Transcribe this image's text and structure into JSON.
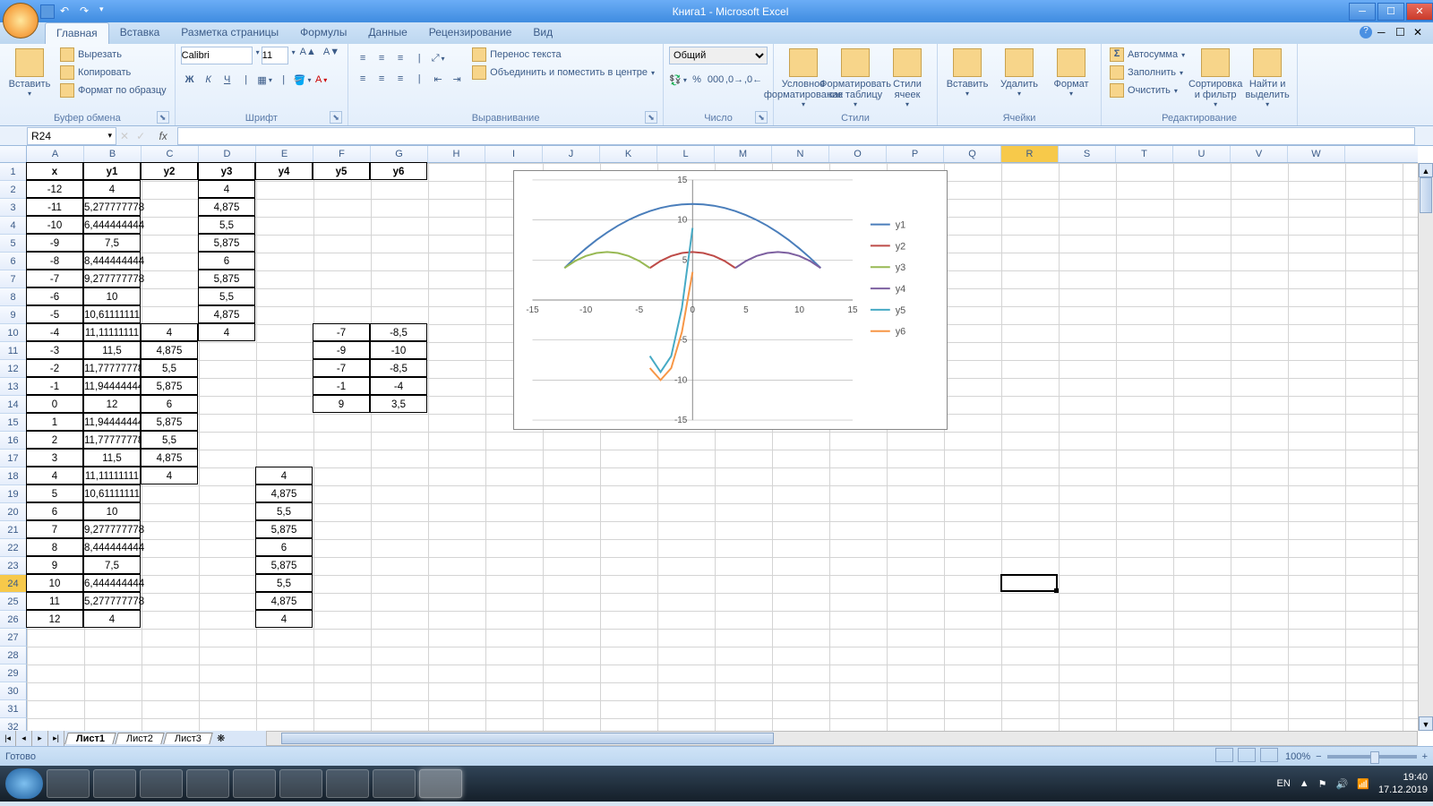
{
  "window": {
    "title": "Книга1 - Microsoft Excel"
  },
  "ribbon_tabs": [
    "Главная",
    "Вставка",
    "Разметка страницы",
    "Формулы",
    "Данные",
    "Рецензирование",
    "Вид"
  ],
  "ribbon": {
    "clipboard": {
      "paste": "Вставить",
      "cut": "Вырезать",
      "copy": "Копировать",
      "format_painter": "Формат по образцу",
      "group": "Буфер обмена"
    },
    "font": {
      "name": "Calibri",
      "size": "11",
      "group": "Шрифт",
      "bold": "Ж",
      "italic": "К",
      "underline": "Ч"
    },
    "align": {
      "wrap": "Перенос текста",
      "merge": "Объединить и поместить в центре",
      "group": "Выравнивание"
    },
    "number": {
      "format": "Общий",
      "group": "Число"
    },
    "styles": {
      "cond": "Условное форматирование",
      "table": "Форматировать как таблицу",
      "cell": "Стили ячеек",
      "group": "Стили"
    },
    "cells": {
      "insert": "Вставить",
      "delete": "Удалить",
      "format": "Формат",
      "group": "Ячейки"
    },
    "editing": {
      "autosum": "Автосумма",
      "fill": "Заполнить",
      "clear": "Очистить",
      "sort": "Сортировка и фильтр",
      "find": "Найти и выделить",
      "group": "Редактирование"
    }
  },
  "namebox": "R24",
  "formula": "",
  "columns": [
    "A",
    "B",
    "C",
    "D",
    "E",
    "F",
    "G",
    "H",
    "I",
    "J",
    "K",
    "L",
    "M",
    "N",
    "O",
    "P",
    "Q",
    "R",
    "S",
    "T",
    "U",
    "V",
    "W"
  ],
  "rows_count": 32,
  "selected_cell": {
    "col": 17,
    "row": 23
  },
  "selected_row_header": 24,
  "selected_col_header": "R",
  "headers_row": [
    "x",
    "y1",
    "y2",
    "y3",
    "y4",
    "y5",
    "y6"
  ],
  "col_a": [
    "-12",
    "-11",
    "-10",
    "-9",
    "-8",
    "-7",
    "-6",
    "-5",
    "-4",
    "-3",
    "-2",
    "-1",
    "0",
    "1",
    "2",
    "3",
    "4",
    "5",
    "6",
    "7",
    "8",
    "9",
    "10",
    "11",
    "12"
  ],
  "col_b": [
    "4",
    "5,277777778",
    "6,444444444",
    "7,5",
    "8,444444444",
    "9,277777778",
    "10",
    "10,61111111",
    "11,11111111",
    "11,5",
    "11,77777778",
    "11,94444444",
    "12",
    "11,94444444",
    "11,77777778",
    "11,5",
    "11,11111111",
    "10,61111111",
    "10",
    "9,277777778",
    "8,444444444",
    "7,5",
    "6,444444444",
    "5,277777778",
    "4"
  ],
  "col_c": {
    "10": "4",
    "11": "4,875",
    "12": "5,5",
    "13": "5,875",
    "14": "6",
    "15": "5,875",
    "16": "5,5",
    "17": "4,875",
    "18": "4"
  },
  "col_d": {
    "2": "4",
    "3": "4,875",
    "4": "5,5",
    "5": "5,875",
    "6": "6",
    "7": "5,875",
    "8": "5,5",
    "9": "4,875",
    "10": "4"
  },
  "col_e": {
    "18": "4",
    "19": "4,875",
    "20": "5,5",
    "21": "5,875",
    "22": "6",
    "23": "5,875",
    "24": "5,5",
    "25": "4,875",
    "26": "4"
  },
  "col_f": {
    "10": "-7",
    "11": "-9",
    "12": "-7",
    "13": "-1",
    "14": "9"
  },
  "col_g": {
    "10": "-8,5",
    "11": "-10",
    "12": "-8,5",
    "13": "-4",
    "14": "3,5"
  },
  "sheets": [
    "Лист1",
    "Лист2",
    "Лист3"
  ],
  "status": {
    "ready": "Готово",
    "zoom": "100%"
  },
  "taskbar": {
    "lang": "EN",
    "time": "19:40",
    "date": "17.12.2019"
  },
  "chart_data": {
    "type": "line",
    "xlim": [
      -15,
      15
    ],
    "ylim": [
      -15,
      15
    ],
    "xticks": [
      -15,
      -10,
      -5,
      0,
      5,
      10,
      15
    ],
    "yticks": [
      -15,
      -10,
      -5,
      0,
      5,
      10,
      15
    ],
    "series": [
      {
        "name": "y1",
        "color": "#4a7ebb",
        "x": [
          -12,
          -11,
          -10,
          -9,
          -8,
          -7,
          -6,
          -5,
          -4,
          -3,
          -2,
          -1,
          0,
          1,
          2,
          3,
          4,
          5,
          6,
          7,
          8,
          9,
          10,
          11,
          12
        ],
        "y": [
          4,
          5.28,
          6.44,
          7.5,
          8.44,
          9.28,
          10,
          10.61,
          11.11,
          11.5,
          11.78,
          11.94,
          12,
          11.94,
          11.78,
          11.5,
          11.11,
          10.61,
          10,
          9.28,
          8.44,
          7.5,
          6.44,
          5.28,
          4
        ]
      },
      {
        "name": "y2",
        "color": "#be4b48",
        "x": [
          -4,
          -3,
          -2,
          -1,
          0,
          1,
          2,
          3,
          4
        ],
        "y": [
          4,
          4.875,
          5.5,
          5.875,
          6,
          5.875,
          5.5,
          4.875,
          4
        ]
      },
      {
        "name": "y3",
        "color": "#98b954",
        "x": [
          -12,
          -11,
          -10,
          -9,
          -8,
          -7,
          -6,
          -5,
          -4
        ],
        "y": [
          4,
          4.875,
          5.5,
          5.875,
          6,
          5.875,
          5.5,
          4.875,
          4
        ]
      },
      {
        "name": "y4",
        "color": "#7d60a0",
        "x": [
          4,
          5,
          6,
          7,
          8,
          9,
          10,
          11,
          12
        ],
        "y": [
          4,
          4.875,
          5.5,
          5.875,
          6,
          5.875,
          5.5,
          4.875,
          4
        ]
      },
      {
        "name": "y5",
        "color": "#46aac5",
        "x": [
          -4,
          -3,
          -2,
          -1,
          0
        ],
        "y": [
          -7,
          -9,
          -7,
          -1,
          9
        ]
      },
      {
        "name": "y6",
        "color": "#f79646",
        "x": [
          -4,
          -3,
          -2,
          -1,
          0
        ],
        "y": [
          -8.5,
          -10,
          -8.5,
          -4,
          3.5
        ]
      }
    ]
  }
}
